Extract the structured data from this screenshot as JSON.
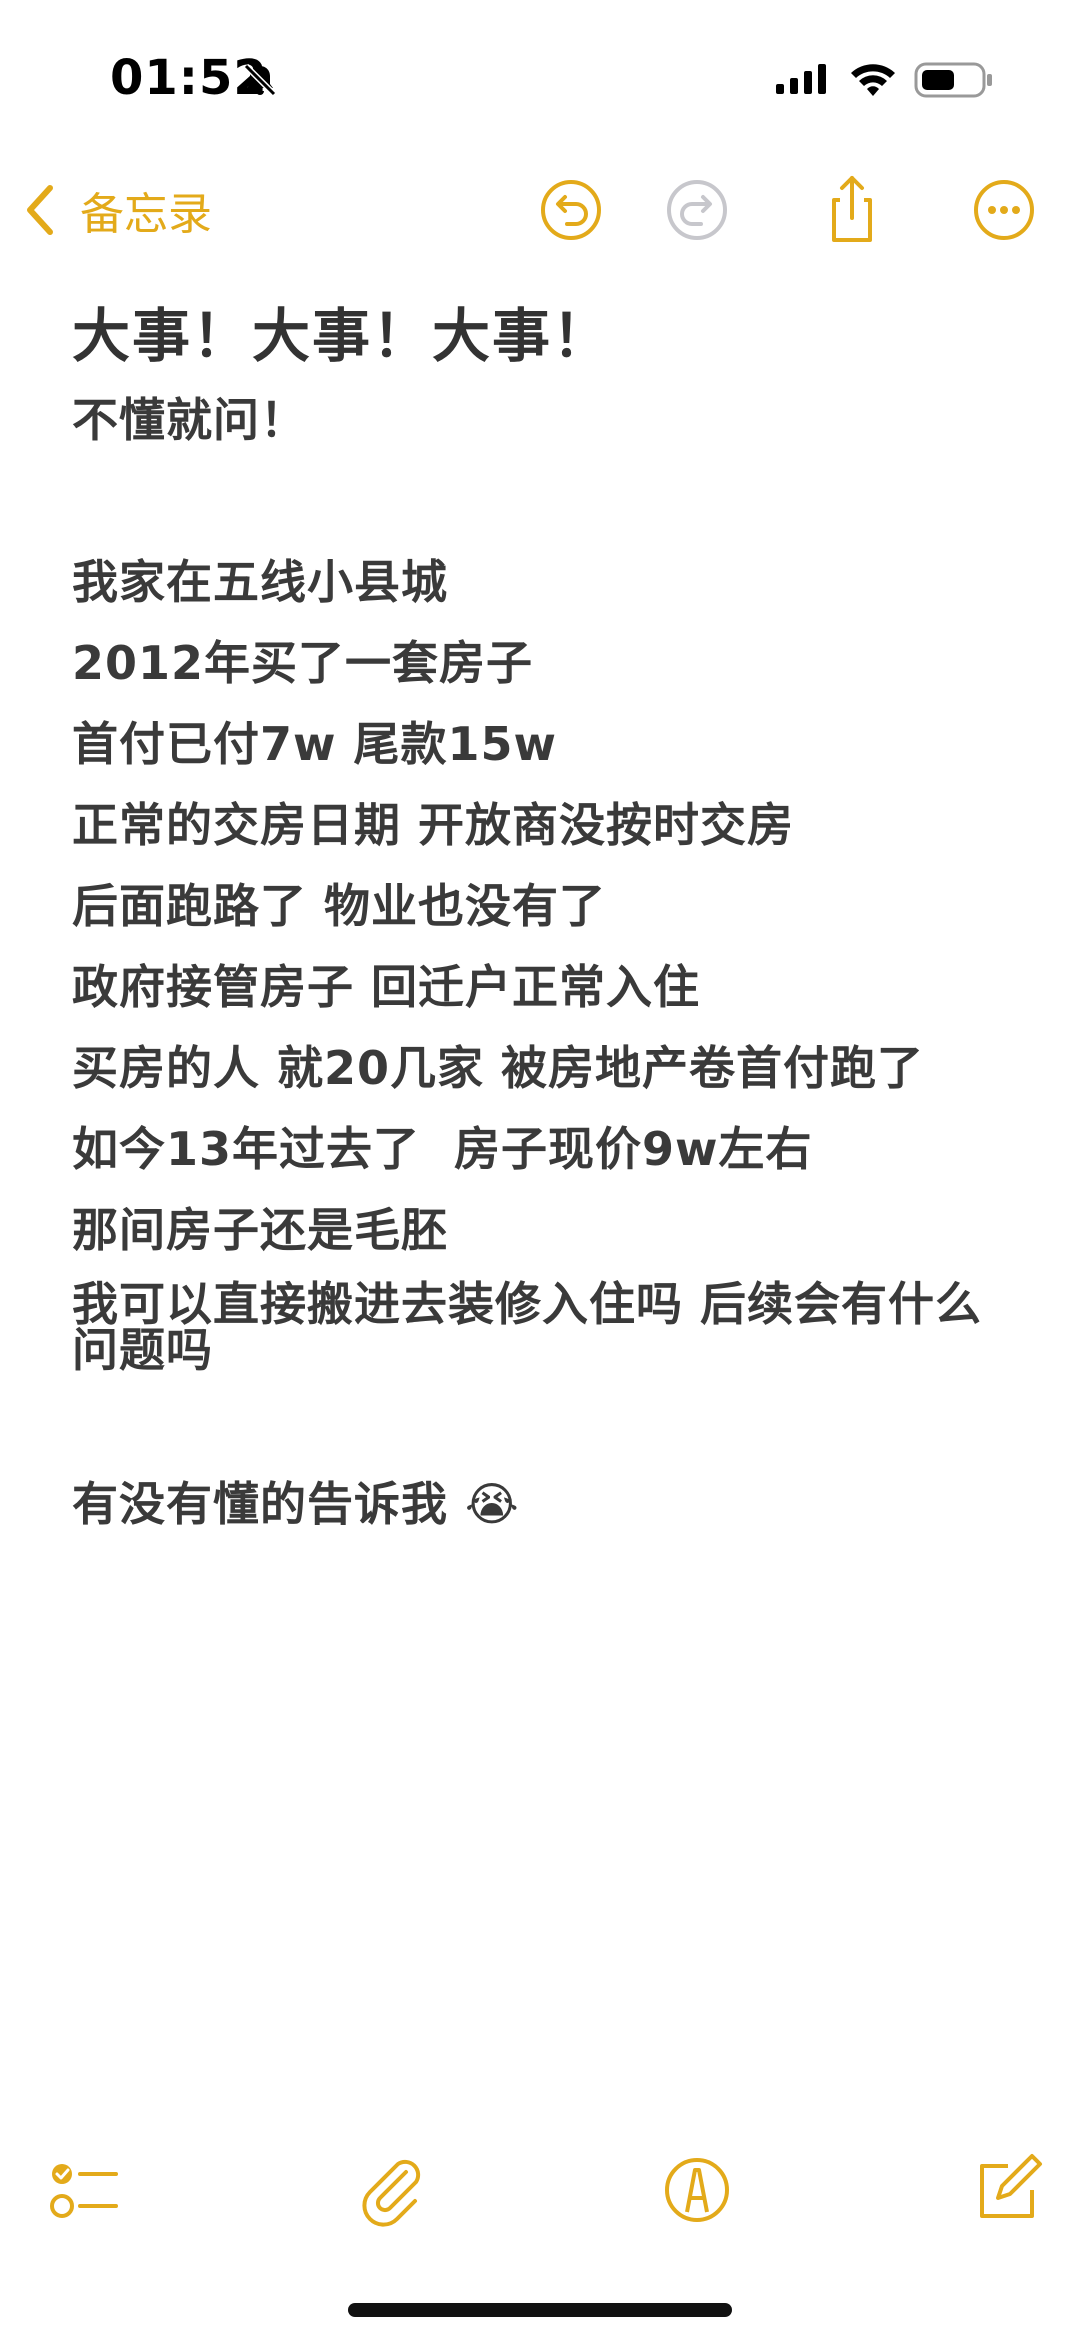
{
  "status_bar": {
    "time": "01:52",
    "icons": [
      "bell-slash-icon",
      "cellular-signal-icon",
      "wifi-icon",
      "battery-icon"
    ]
  },
  "nav": {
    "back_label": "备忘录",
    "accent_color": "#E3AA1A",
    "disabled_color": "#C7C7CC",
    "icons": [
      "undo-icon",
      "redo-icon",
      "share-icon",
      "more-icon"
    ]
  },
  "note": {
    "title": "大事！大事！大事！",
    "lines": [
      "不懂就问！",
      "",
      "我家在五线小县城",
      "2012年买了一套房子",
      "首付已付7w 尾款15w",
      "正常的交房日期 开放商没按时交房",
      "后面跑路了 物业也没有了",
      "政府接管房子 回迁户正常入住",
      "买房的人 就20几家 被房地产卷首付跑了",
      "如今13年过去了  房子现价9w左右",
      "那间房子还是毛胚",
      "我可以直接搬进去装修入住吗 后续会有什么问题吗",
      "",
      "有没有懂的告诉我 😭"
    ]
  },
  "toolbar": {
    "icons": [
      "checklist-icon",
      "paperclip-icon",
      "markup-pen-icon",
      "compose-icon"
    ]
  }
}
